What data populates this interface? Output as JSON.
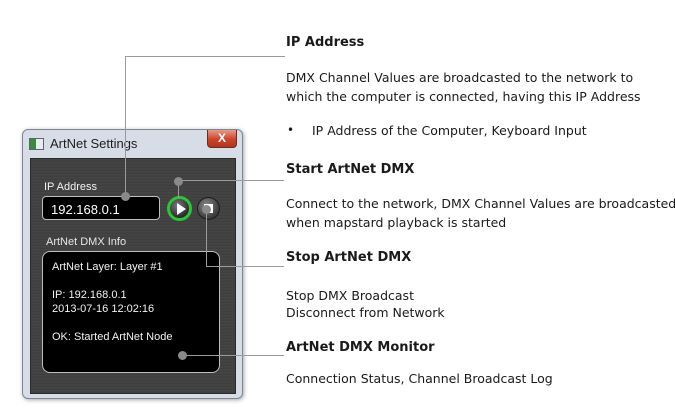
{
  "window": {
    "title": "ArtNet Settings",
    "close_glyph": "X"
  },
  "settings": {
    "ip_label": "IP Address",
    "ip_value": "192.168.0.1",
    "info_label": "ArtNet DMX Info"
  },
  "monitor": {
    "lines": [
      "ArtNet Layer: Layer #1",
      "",
      "IP: 192.168.0.1",
      "2013-07-16 12:02:16",
      "",
      "OK: Started ArtNet Node"
    ]
  },
  "callouts": {
    "ip": {
      "heading": "IP Address",
      "desc_line1": "DMX Channel Values are broadcasted to the network to",
      "desc_line2": "which the computer is connected, having this IP Address",
      "bullet_symbol": "•",
      "bullet": "IP Address of the  Computer, Keyboard Input"
    },
    "start": {
      "heading": "Start ArtNet DMX",
      "desc_line1": "Connect to the network, DMX Channel Values are broadcasted",
      "desc_line2": "when mapstard playback is started"
    },
    "stop": {
      "heading": "Stop ArtNet DMX",
      "desc_line1": "Stop DMX Broadcast",
      "desc_line2": "Disconnect from Network"
    },
    "monitor": {
      "heading": "ArtNet DMX Monitor",
      "desc_line1": "Connection Status, Channel Broadcast Log"
    }
  },
  "icons": {
    "play": "play-icon",
    "stop": "stop-icon",
    "app": "artnet-app-icon"
  },
  "colors": {
    "play_ring": "#2fc23a",
    "connector": "#9a9a9a",
    "close_button": "#c8452c"
  }
}
